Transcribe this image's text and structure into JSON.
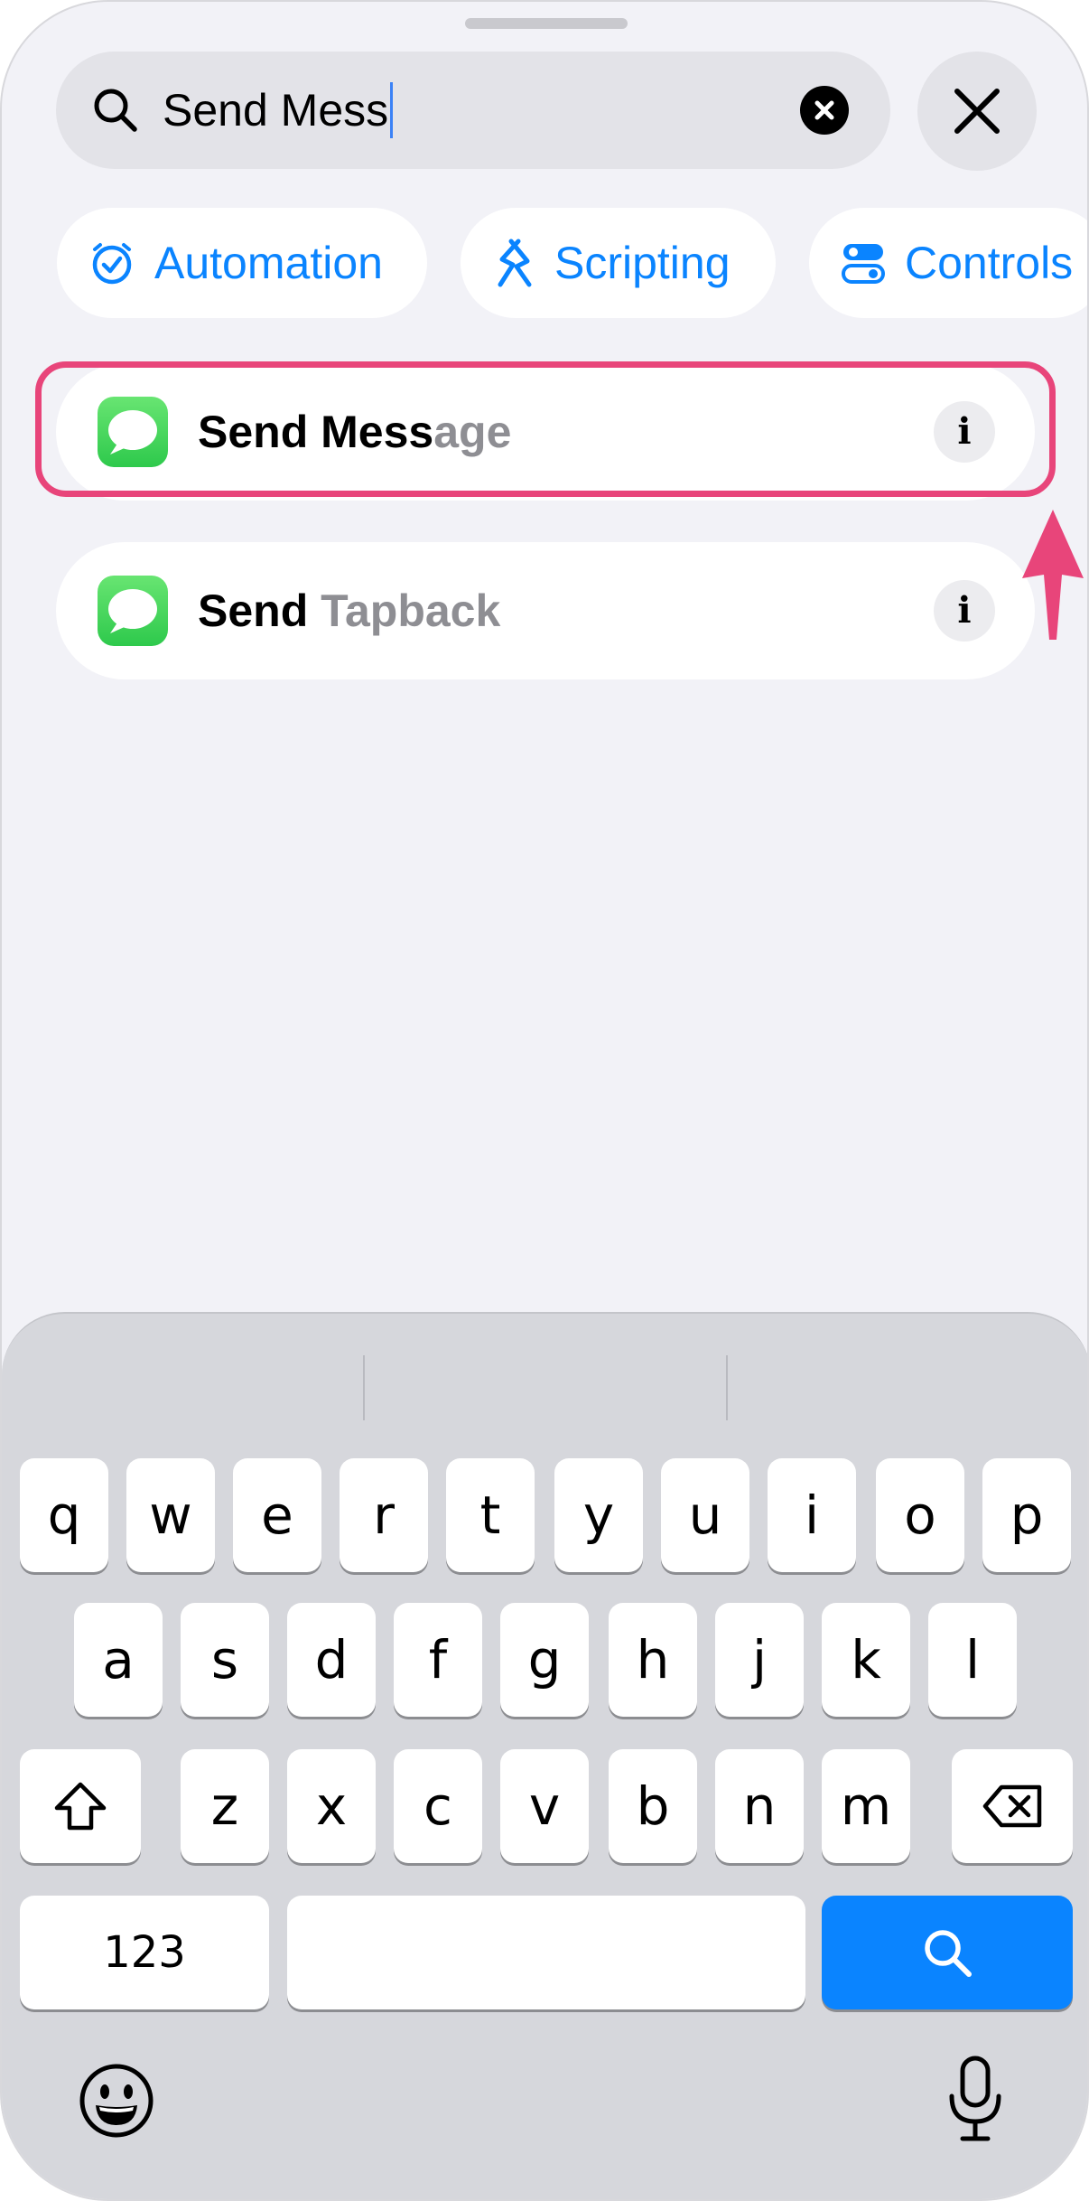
{
  "search": {
    "query": "Send Mess"
  },
  "chips": [
    {
      "label": "Automation",
      "icon": "clock-check-icon"
    },
    {
      "label": "Scripting",
      "icon": "scripting-icon"
    },
    {
      "label": "Controls",
      "icon": "toggles-icon"
    }
  ],
  "results": [
    {
      "match": "Send Mess",
      "rest": "age",
      "icon": "messages-icon",
      "highlighted": true
    },
    {
      "match": "Send ",
      "rest": "Tapback",
      "icon": "messages-icon",
      "highlighted": false
    }
  ],
  "info_label": "i",
  "keyboard": {
    "row1": [
      "q",
      "w",
      "e",
      "r",
      "t",
      "y",
      "u",
      "i",
      "o",
      "p"
    ],
    "row2": [
      "a",
      "s",
      "d",
      "f",
      "g",
      "h",
      "j",
      "k",
      "l"
    ],
    "row3": [
      "z",
      "x",
      "c",
      "v",
      "b",
      "n",
      "m"
    ],
    "numbers_key": "123",
    "space_key": "",
    "accent_color": "#0a84ff"
  },
  "colors": {
    "accent": "#0a84ff",
    "highlight": "#e8457a",
    "messages_green": "#34c759"
  }
}
